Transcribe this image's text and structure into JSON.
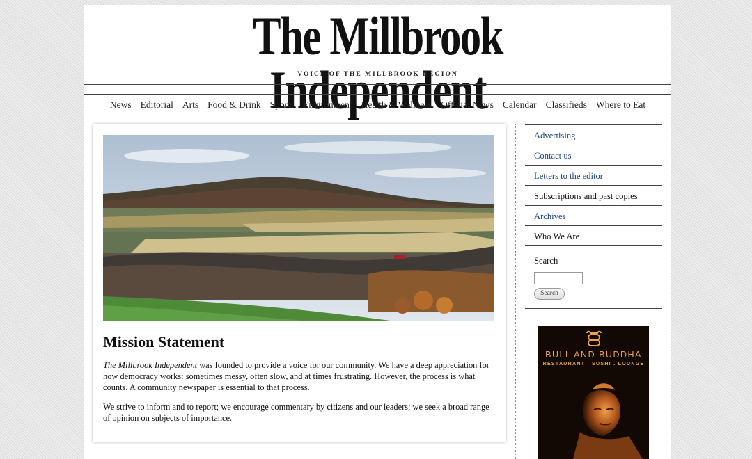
{
  "masthead": {
    "title": "The Millbrook Independent",
    "tagline": "VOICE OF THE MILLBROOK REGION"
  },
  "nav": {
    "items": [
      "News",
      "Editorial",
      "Arts",
      "Food & Drink",
      "Sports",
      "Environment",
      "Health & Wellness",
      "Official News",
      "Calendar",
      "Classifieds",
      "Where to Eat"
    ]
  },
  "main": {
    "photo_alt": "Rolling hills landscape in autumn",
    "heading": "Mission Statement",
    "paragraph1_italic": "The Millbrook Independent",
    "paragraph1_rest": " was founded to provide a voice for our community. We have a deep appreciation for how democracy works: sometimes messy, often slow, and at times frustrating. However, the process is what counts. A community newspaper is essential to that process.",
    "paragraph2": "We strive to inform and to report; we encourage commentary by citizens and our leaders; we seek a broad range of opinion on subjects of importance."
  },
  "sidebar": {
    "links": [
      {
        "label": "Advertising"
      },
      {
        "label": "Contact us"
      },
      {
        "label": "Letters to the editor"
      },
      {
        "label": "Subscriptions and past copies"
      },
      {
        "label": "Archives"
      },
      {
        "label": "Who We Are"
      }
    ],
    "search_label": "Search",
    "search_value": "",
    "search_button": "Search"
  },
  "ad": {
    "name": "BULL AND BUDDHA",
    "subtitle": "RESTAURANT . SUSHI . LOUNGE"
  },
  "colors": {
    "link_blue": "#1b3f77",
    "ad_gold": "#e9a14a",
    "ad_bg": "#120905"
  }
}
